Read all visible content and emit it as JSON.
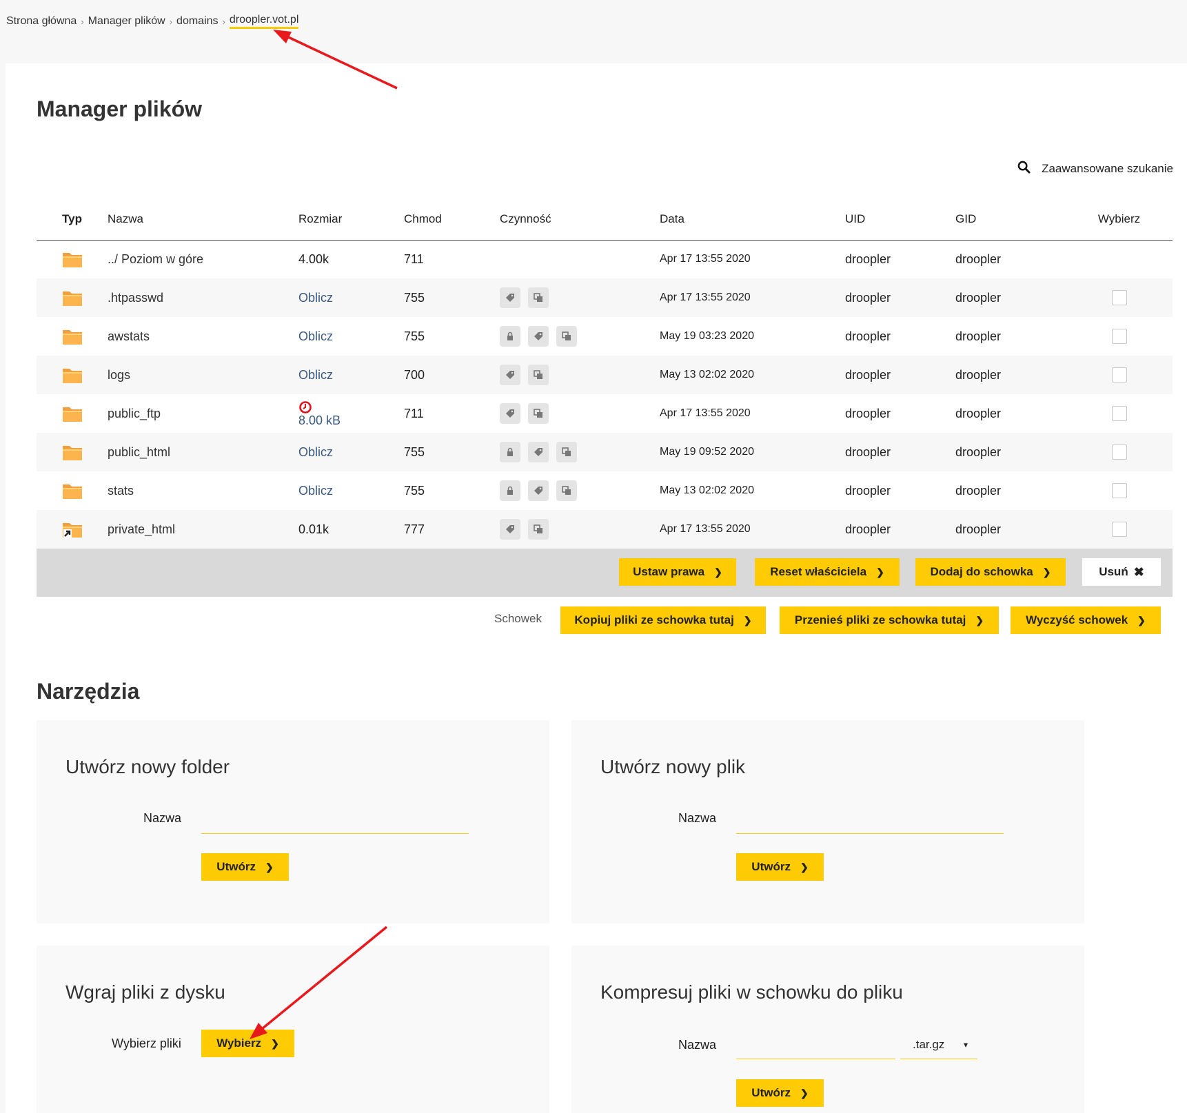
{
  "breadcrumb": {
    "items": [
      "Strona główna",
      "Manager plików",
      "domains"
    ],
    "current": "droopler.vot.pl"
  },
  "page": {
    "title": "Manager plików"
  },
  "search": {
    "label": "Zaawansowane szukanie",
    "icon": "search-icon"
  },
  "table": {
    "headers": [
      "Typ",
      "Nazwa",
      "Rozmiar",
      "Chmod",
      "Czynność",
      "Data",
      "UID",
      "GID",
      "Wybierz"
    ],
    "rows": [
      {
        "name": "../ Poziom w góre",
        "size": "4.00k",
        "chmod": "711",
        "date": "Apr 17 13:55 2020",
        "uid": "droopler",
        "gid": "droopler"
      },
      {
        "name": ".htpasswd",
        "size": "Oblicz",
        "chmod": "755",
        "date": "Apr 17 13:55 2020",
        "uid": "droopler",
        "gid": "droopler"
      },
      {
        "name": "awstats",
        "size": "Oblicz",
        "chmod": "755",
        "date": "May 19 03:23 2020",
        "uid": "droopler",
        "gid": "droopler"
      },
      {
        "name": "logs",
        "size": "Oblicz",
        "chmod": "700",
        "date": "May 13 02:02 2020",
        "uid": "droopler",
        "gid": "droopler"
      },
      {
        "name": "public_ftp",
        "size": "8.00 kB",
        "chmod": "711",
        "date": "Apr 17 13:55 2020",
        "uid": "droopler",
        "gid": "droopler"
      },
      {
        "name": "public_html",
        "size": "Oblicz",
        "chmod": "755",
        "date": "May 19 09:52 2020",
        "uid": "droopler",
        "gid": "droopler"
      },
      {
        "name": "stats",
        "size": "Oblicz",
        "chmod": "755",
        "date": "May 13 02:02 2020",
        "uid": "droopler",
        "gid": "droopler"
      },
      {
        "name": "private_html",
        "size": "0.01k",
        "chmod": "777",
        "date": "Apr 17 13:55 2020",
        "uid": "droopler",
        "gid": "droopler"
      }
    ]
  },
  "actions": {
    "set_perms": "Ustaw prawa",
    "reset_owner": "Reset właściciela",
    "add_clipboard": "Dodaj do schowka",
    "delete": "Usuń"
  },
  "clipboard": {
    "label": "Schowek",
    "copy_here": "Kopiuj pliki ze schowka tutaj",
    "move_here": "Przenieś pliki ze schowka tutaj",
    "clear": "Wyczyść schowek"
  },
  "tools": {
    "title": "Narzędzia",
    "new_folder": {
      "title": "Utwórz nowy folder",
      "label": "Nazwa",
      "button": "Utwórz"
    },
    "new_file": {
      "title": "Utwórz nowy plik",
      "label": "Nazwa",
      "button": "Utwórz"
    },
    "upload": {
      "title": "Wgraj pliki z dysku",
      "label": "Wybierz pliki",
      "button": "Wybierz"
    },
    "compress": {
      "title": "Kompresuj pliki w schowku do pliku",
      "label": "Nazwa",
      "format": ".tar.gz",
      "button": "Utwórz"
    }
  },
  "colors": {
    "accent": "#ffcb05",
    "annotation_arrow": "#e8191c",
    "link": "#3b5a80"
  }
}
